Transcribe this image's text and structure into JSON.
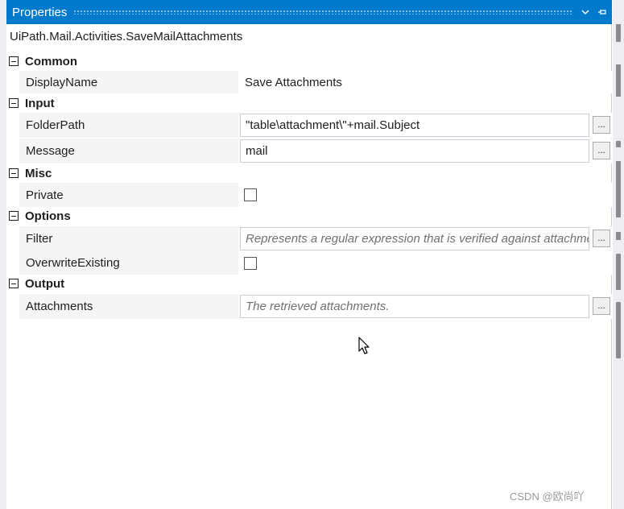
{
  "panel": {
    "title": "Properties",
    "icons": {
      "dropdown": "chevron-down-icon",
      "pin": "pin-icon"
    }
  },
  "type_name": "UiPath.Mail.Activities.SaveMailAttachments",
  "categories": {
    "common": {
      "label": "Common",
      "display_name": {
        "label": "DisplayName",
        "value": "Save Attachments"
      }
    },
    "input": {
      "label": "Input",
      "folder_path": {
        "label": "FolderPath",
        "value": "\"table\\attachment\\\"+mail.Subject"
      },
      "message": {
        "label": "Message",
        "value": "mail"
      }
    },
    "misc": {
      "label": "Misc",
      "private": {
        "label": "Private",
        "checked": false
      }
    },
    "options": {
      "label": "Options",
      "filter": {
        "label": "Filter",
        "placeholder": "Represents a regular expression that is verified against attachment names"
      },
      "overwrite_existing": {
        "label": "OverwriteExisting",
        "checked": false
      }
    },
    "output": {
      "label": "Output",
      "attachments": {
        "label": "Attachments",
        "placeholder": "The retrieved attachments."
      }
    }
  },
  "ellipsis_label": "...",
  "watermark": "CSDN @欧尚吖",
  "colors": {
    "titlebar": "#007acc",
    "name_column": "#f5f5f5"
  }
}
